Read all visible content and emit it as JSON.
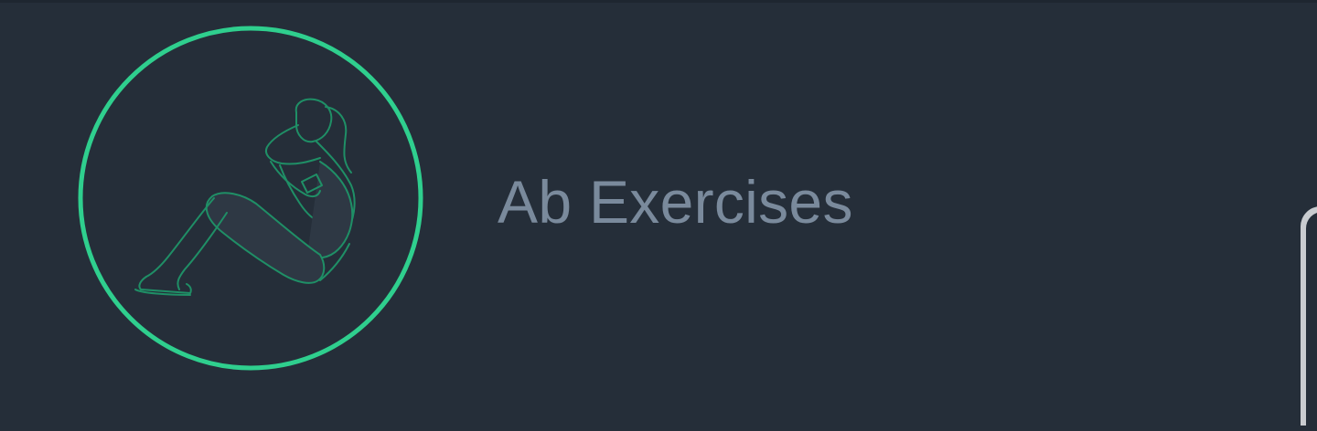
{
  "item": {
    "title": "Ab Exercises",
    "icon": "situp-exercise-icon"
  },
  "colors": {
    "background": "#252e39",
    "accent": "#2fcf8e",
    "title_text": "#7a8a9c"
  }
}
